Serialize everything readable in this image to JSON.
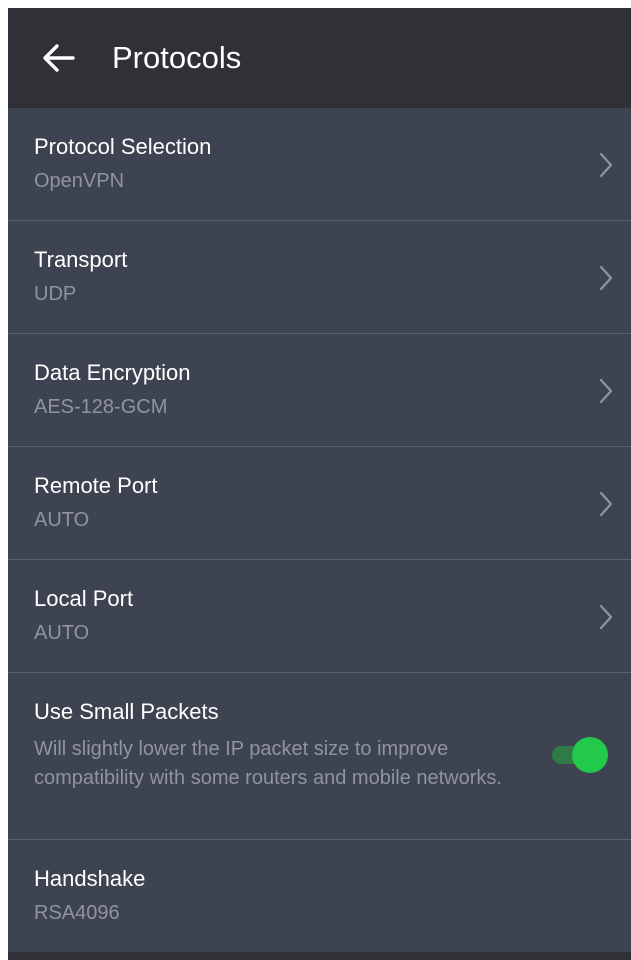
{
  "appbar": {
    "title": "Protocols",
    "back_icon": "arrow-left-icon"
  },
  "settings": [
    {
      "label": "Protocol Selection",
      "value": "OpenVPN",
      "chevron_icon": "chevron-right-icon"
    },
    {
      "label": "Transport",
      "value": "UDP",
      "chevron_icon": "chevron-right-icon"
    },
    {
      "label": "Data Encryption",
      "value": "AES-128-GCM",
      "chevron_icon": "chevron-right-icon"
    },
    {
      "label": "Remote Port",
      "value": "AUTO",
      "chevron_icon": "chevron-right-icon"
    },
    {
      "label": "Local Port",
      "value": "AUTO",
      "chevron_icon": "chevron-right-icon"
    }
  ],
  "small_packets": {
    "label": "Use Small Packets",
    "description": "Will slightly lower the IP packet size to improve compatibility with some routers and mobile networks.",
    "enabled": true
  },
  "handshake": {
    "label": "Handshake",
    "value": "RSA4096"
  },
  "colors": {
    "background": "#3d4350",
    "appbar": "#2f3136",
    "divider": "#5a606c",
    "secondary_text": "#8f949e",
    "toggle_on": "#22c94a"
  }
}
